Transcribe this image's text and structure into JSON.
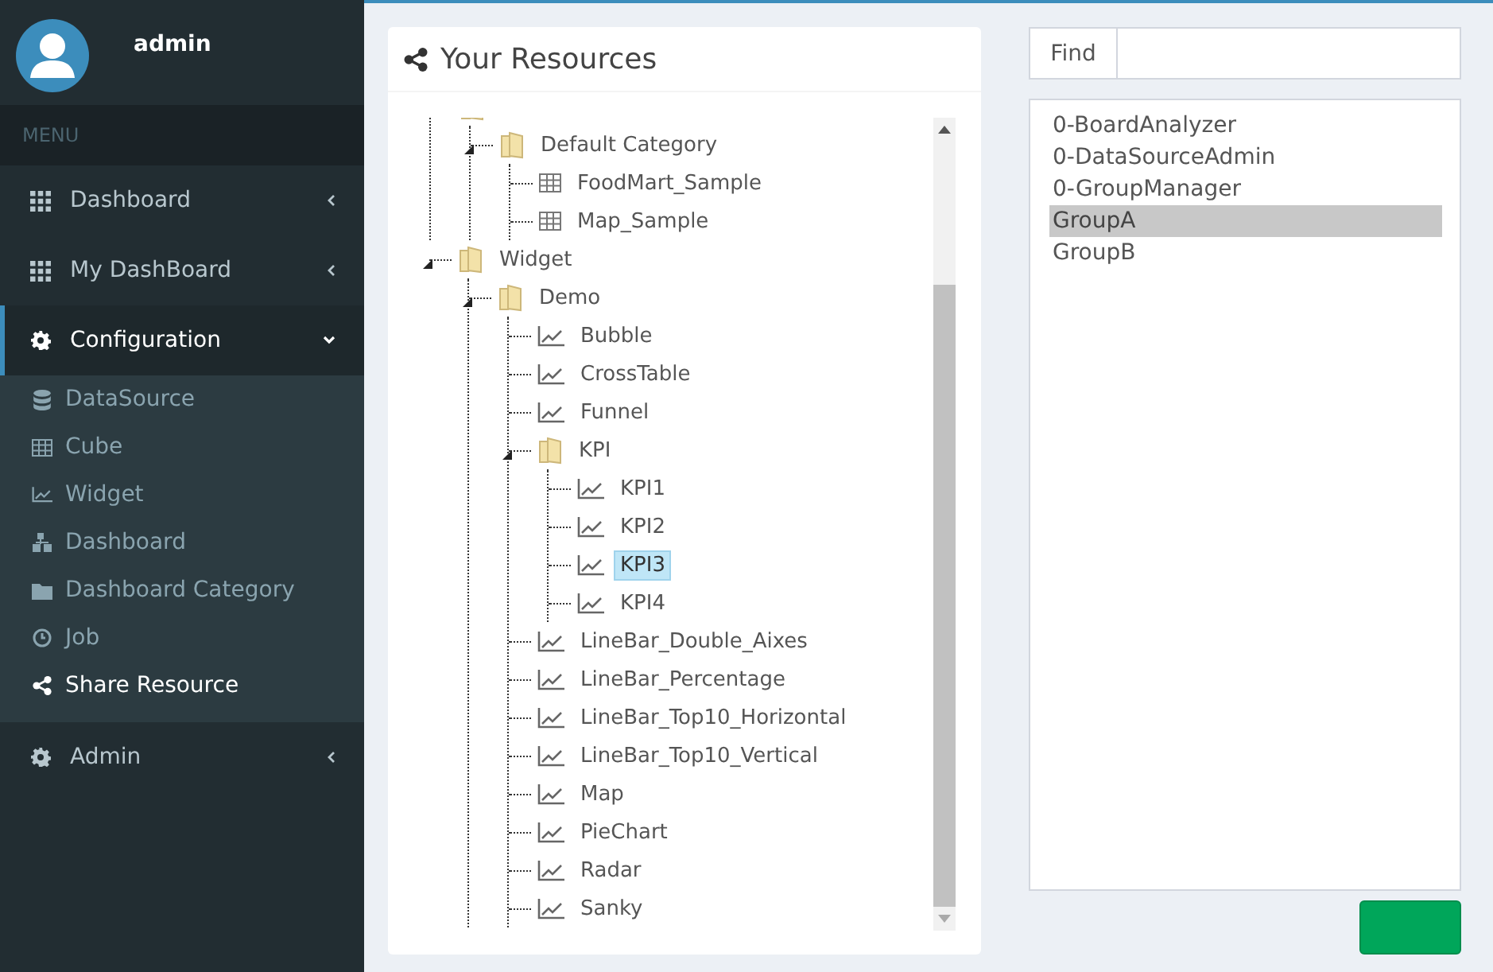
{
  "user": {
    "name": "admin"
  },
  "menu": {
    "header": "MENU",
    "items": [
      {
        "kind": "grid",
        "label": "Dashboard",
        "expanded": false,
        "selected": false
      },
      {
        "kind": "grid",
        "label": "My DashBoard",
        "expanded": false,
        "selected": false
      },
      {
        "kind": "gear",
        "label": "Configuration",
        "expanded": true,
        "selected": true,
        "children": [
          {
            "kind": "database",
            "label": "DataSource",
            "selected": false
          },
          {
            "kind": "table",
            "label": "Cube",
            "selected": false
          },
          {
            "kind": "chart",
            "label": "Widget",
            "selected": false
          },
          {
            "kind": "sitemap",
            "label": "Dashboard",
            "selected": false
          },
          {
            "kind": "folder",
            "label": "Dashboard Category",
            "selected": false
          },
          {
            "kind": "clock",
            "label": "Job",
            "selected": false
          },
          {
            "kind": "share",
            "label": "Share Resource",
            "selected": true
          }
        ]
      },
      {
        "kind": "gear",
        "label": "Admin",
        "expanded": false,
        "selected": false
      }
    ]
  },
  "resources": {
    "title": "Your Resources",
    "tree": [
      {
        "kind": "folder",
        "expanded": true,
        "children": [
          {
            "kind": "folder",
            "label": "Default Category",
            "expanded": true,
            "selected": false,
            "children": [
              {
                "kind": "table",
                "label": "FoodMart_Sample",
                "selected": false
              },
              {
                "kind": "table",
                "label": "Map_Sample",
                "selected": false
              }
            ]
          }
        ]
      },
      {
        "kind": "folder",
        "label": "Widget",
        "expanded": true,
        "selected": false,
        "children": [
          {
            "kind": "folder",
            "label": "Demo",
            "expanded": true,
            "selected": false,
            "children": [
              {
                "kind": "chart",
                "label": "Bubble",
                "selected": false
              },
              {
                "kind": "chart",
                "label": "CrossTable",
                "selected": false
              },
              {
                "kind": "chart",
                "label": "Funnel",
                "selected": false
              },
              {
                "kind": "folder",
                "label": "KPI",
                "expanded": true,
                "selected": false,
                "children": [
                  {
                    "kind": "chart",
                    "label": "KPI1",
                    "selected": false
                  },
                  {
                    "kind": "chart",
                    "label": "KPI2",
                    "selected": false
                  },
                  {
                    "kind": "chart",
                    "label": "KPI3",
                    "selected": true
                  },
                  {
                    "kind": "chart",
                    "label": "KPI4",
                    "selected": false
                  }
                ]
              },
              {
                "kind": "chart",
                "label": "LineBar_Double_Aixes",
                "selected": false
              },
              {
                "kind": "chart",
                "label": "LineBar_Percentage",
                "selected": false
              },
              {
                "kind": "chart",
                "label": "LineBar_Top10_Horizontal",
                "selected": false
              },
              {
                "kind": "chart",
                "label": "LineBar_Top10_Vertical",
                "selected": false
              },
              {
                "kind": "chart",
                "label": "Map",
                "selected": false
              },
              {
                "kind": "chart",
                "label": "PieChart",
                "selected": false
              },
              {
                "kind": "chart",
                "label": "Radar",
                "selected": false
              },
              {
                "kind": "chart",
                "label": "Sanky",
                "selected": false
              }
            ]
          }
        ]
      }
    ]
  },
  "find": {
    "label": "Find"
  },
  "groups": [
    {
      "label": "0-BoardAnalyzer",
      "selected": false
    },
    {
      "label": "0-DataSourceAdmin",
      "selected": false
    },
    {
      "label": "0-GroupManager",
      "selected": false
    },
    {
      "label": "GroupA",
      "selected": true
    },
    {
      "label": "GroupB",
      "selected": false
    }
  ]
}
